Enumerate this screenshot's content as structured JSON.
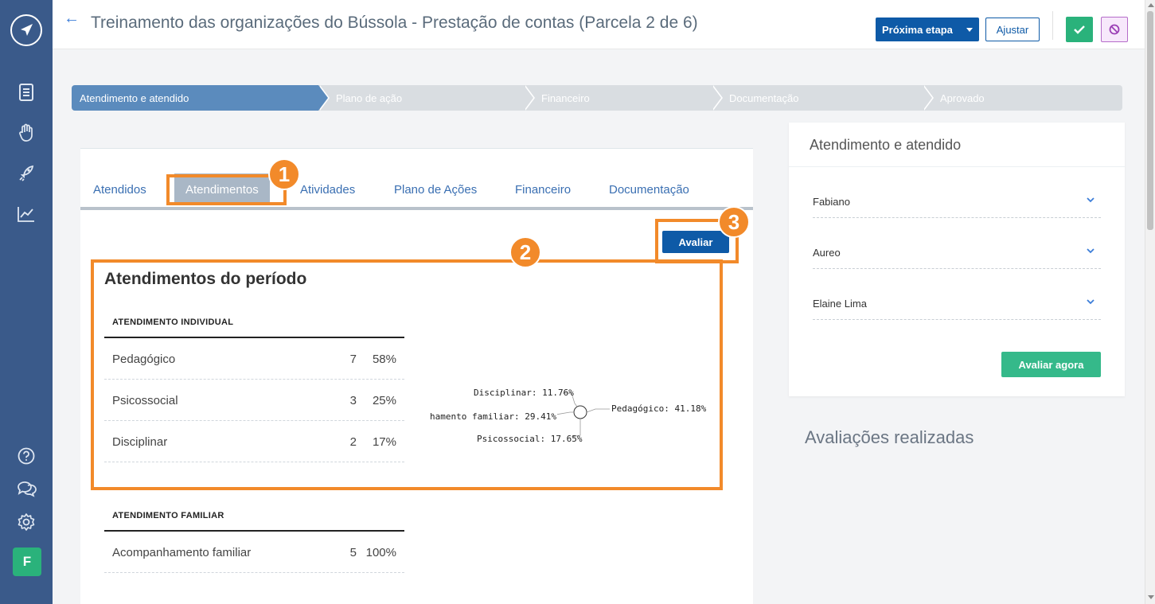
{
  "header": {
    "title": "Treinamento das organizações do Bússola - Prestação de contas (Parcela 2 de 6)",
    "next_label": "Próxima etapa",
    "adjust_label": "Ajustar"
  },
  "sidebar": {
    "avatar_letter": "F",
    "icons": [
      "logo-icon",
      "document-icon",
      "hand-icon",
      "rocket-icon",
      "chart-icon",
      "help-icon",
      "chat-icon",
      "gear-icon"
    ]
  },
  "stepper": {
    "steps": [
      "Atendimento e atendido",
      "Plano de ação",
      "Financeiro",
      "Documentação",
      "Aprovado"
    ],
    "active_index": 0
  },
  "tabs": [
    "Atendidos",
    "Atendimentos",
    "Atividades",
    "Plano de Ações",
    "Financeiro",
    "Documentação"
  ],
  "active_tab": "Atendimentos",
  "avaliar_label": "Avaliar",
  "section_title": "Atendimentos do período",
  "individual": {
    "header": "ATENDIMENTO INDIVIDUAL",
    "rows": [
      {
        "label": "Pedagógico",
        "count": "7",
        "pct": "58%"
      },
      {
        "label": "Psicossocial",
        "count": "3",
        "pct": "25%"
      },
      {
        "label": "Disciplinar",
        "count": "2",
        "pct": "17%"
      }
    ]
  },
  "familiar": {
    "header": "ATENDIMENTO FAMILIAR",
    "rows": [
      {
        "label": "Acompanhamento familiar",
        "count": "5",
        "pct": "100%"
      }
    ]
  },
  "pie": {
    "labels": {
      "disciplinar": "Disciplinar: 11.76%",
      "familiar": "hamento familiar: 29.41%",
      "pedagogico": "Pedagógico: 41.18%",
      "psicossocial": "Psicossocial: 17.65%"
    }
  },
  "panel": {
    "title": "Atendimento e atendido",
    "selects": [
      "Fabiano",
      "Aureo",
      "Elaine Lima"
    ],
    "button": "Avaliar agora",
    "done_title": "Avaliações realizadas"
  },
  "annotations": [
    "1",
    "2",
    "3"
  ],
  "colors": {
    "sidebar": "#3a5a8a",
    "primary": "#0e5aa7",
    "success": "#2ab27b",
    "annotation": "#f28a2a",
    "step_active": "#5b8bbd"
  }
}
